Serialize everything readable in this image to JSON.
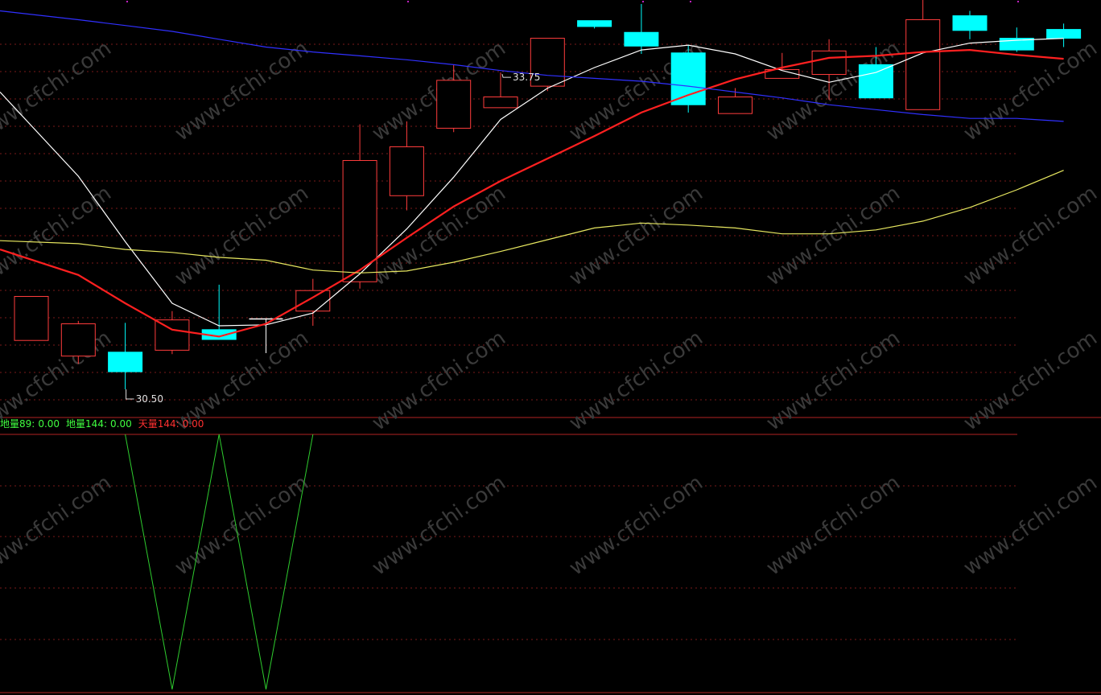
{
  "chart_data": [
    {
      "type": "candlestick",
      "candles": [
        {
          "open": 31.0,
          "close": 31.45,
          "high": 31.45,
          "low": 31.0
        },
        {
          "open": 30.84,
          "close": 31.17,
          "high": 31.2,
          "low": 30.76
        },
        {
          "open": 30.88,
          "close": 30.68,
          "high": 31.18,
          "low": 30.5
        },
        {
          "open": 30.9,
          "close": 31.21,
          "high": 31.3,
          "low": 30.86
        },
        {
          "open": 31.11,
          "close": 31.01,
          "high": 31.57,
          "low": 31.01
        },
        {
          "open": 31.22,
          "close": 31.22,
          "high": 31.22,
          "low": 30.87
        },
        {
          "open": 31.3,
          "close": 31.51,
          "high": 31.63,
          "low": 31.15
        },
        {
          "open": 31.6,
          "close": 32.84,
          "high": 33.21,
          "low": 31.53
        },
        {
          "open": 32.48,
          "close": 32.98,
          "high": 33.24,
          "low": 32.33
        },
        {
          "open": 33.17,
          "close": 33.66,
          "high": 33.82,
          "low": 33.13
        },
        {
          "open": 33.38,
          "close": 33.49,
          "high": 33.74,
          "low": 33.38
        },
        {
          "open": 33.6,
          "close": 34.09,
          "high": 34.09,
          "low": 33.55
        },
        {
          "open": 34.27,
          "close": 34.21,
          "high": 34.27,
          "low": 34.19
        },
        {
          "open": 34.15,
          "close": 34.01,
          "high": 34.44,
          "low": 33.93
        },
        {
          "open": 33.94,
          "close": 33.41,
          "high": 34.02,
          "low": 33.33
        },
        {
          "open": 33.32,
          "close": 33.49,
          "high": 33.58,
          "low": 33.32
        },
        {
          "open": 33.68,
          "close": 33.77,
          "high": 33.94,
          "low": 33.68
        },
        {
          "open": 33.72,
          "close": 33.96,
          "high": 34.08,
          "low": 33.46
        },
        {
          "open": 33.82,
          "close": 33.48,
          "high": 34.0,
          "low": 33.48
        },
        {
          "open": 33.36,
          "close": 34.28,
          "high": 34.56,
          "low": 33.36
        },
        {
          "open": 34.32,
          "close": 34.17,
          "high": 34.37,
          "low": 34.08
        },
        {
          "open": 34.09,
          "close": 33.97,
          "high": 34.2,
          "low": 33.95
        },
        {
          "open": 34.18,
          "close": 34.09,
          "high": 34.24,
          "low": 34.0
        }
      ],
      "series": [
        {
          "color": "#ffffff",
          "values": [
            33.54,
            32.68,
            32.01,
            31.38,
            31.15,
            31.16,
            31.28,
            31.68,
            32.14,
            32.67,
            33.26,
            33.58,
            33.79,
            33.97,
            34.02,
            33.93,
            33.76,
            33.64,
            33.74,
            33.94,
            34.04,
            34.07,
            34.09
          ]
        },
        {
          "color": "#ff2020",
          "values": [
            31.93,
            31.67,
            31.38,
            31.11,
            31.04,
            31.17,
            31.44,
            31.72,
            32.05,
            32.37,
            32.63,
            32.86,
            33.09,
            33.33,
            33.51,
            33.67,
            33.79,
            33.89,
            33.91,
            33.95,
            33.97,
            33.92,
            33.88
          ]
        },
        {
          "color": "#3030ff",
          "values": [
            34.37,
            34.28,
            34.22,
            34.16,
            34.08,
            34.0,
            33.95,
            33.91,
            33.87,
            33.82,
            33.76,
            33.71,
            33.68,
            33.65,
            33.6,
            33.54,
            33.48,
            33.41,
            33.36,
            33.31,
            33.27,
            33.27,
            33.24
          ]
        },
        {
          "color": "#e8e860",
          "values": [
            32.02,
            31.99,
            31.93,
            31.9,
            31.85,
            31.82,
            31.72,
            31.69,
            31.71,
            31.8,
            31.91,
            32.03,
            32.15,
            32.2,
            32.18,
            32.15,
            32.09,
            32.09,
            32.13,
            32.22,
            32.36,
            32.54,
            32.74
          ]
        }
      ],
      "annotations": {
        "high_label": "33.75",
        "low_label": "30.50"
      },
      "colors": {
        "up": "#ff3c3c",
        "down": "#00ffff"
      }
    },
    {
      "type": "line",
      "legend": [
        {
          "label": "地量89:",
          "value": "0.00",
          "color": "#40ff40"
        },
        {
          "label": "地量144:",
          "value": "0.00",
          "color": "#40ff40"
        },
        {
          "label": "天量144:",
          "value": "0.00",
          "color": "#ff3030"
        }
      ],
      "series": [
        {
          "color": "#2ecc2e",
          "values": [
            null,
            null,
            1,
            0,
            1,
            0,
            1,
            null,
            null,
            null,
            null,
            null,
            null,
            null,
            null,
            null,
            null,
            null,
            null,
            null,
            null,
            null,
            null
          ]
        }
      ]
    }
  ],
  "watermark": "www.cfchi.com"
}
